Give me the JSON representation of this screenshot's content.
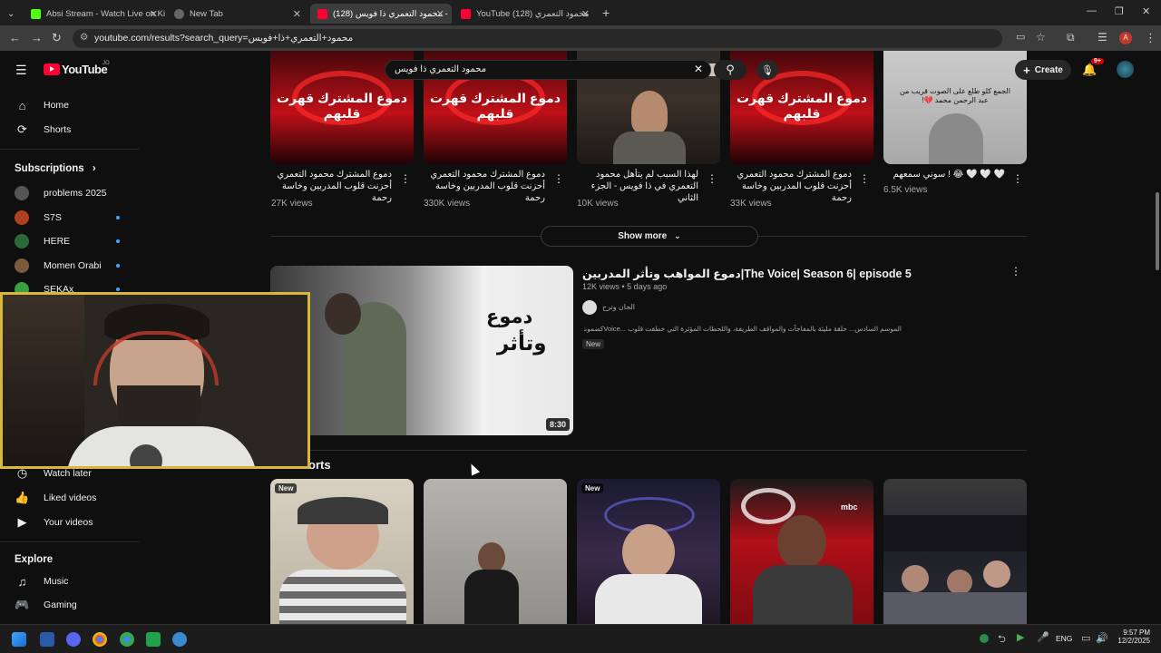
{
  "browser": {
    "tabs": [
      {
        "title": "Absi Stream - Watch Live on Ki",
        "favicon": "kick-icon",
        "color": "#53fc18"
      },
      {
        "title": "New Tab",
        "favicon": "globe-icon",
        "color": "#888888"
      },
      {
        "title": "محمود التعمري ذا فويس (128) -",
        "favicon": "youtube-icon",
        "color": "#ff0033"
      },
      {
        "title": "YouTube محمود التعمري (128)",
        "favicon": "youtube-icon",
        "color": "#ff0033"
      }
    ],
    "url": "youtube.com/results?search_query=محمود+التعمري+ذا+فويس"
  },
  "youtube": {
    "logo": "YouTube",
    "country": "JO",
    "search_value": "محمود التعمري ذا فويس",
    "create_label": "Create",
    "notif_count": "9+",
    "avatar_letter": "A"
  },
  "sidebar": {
    "home": "Home",
    "shorts": "Shorts",
    "subscriptions": "Subscriptions",
    "subs": [
      {
        "name": "problems 2025",
        "color": "#555555",
        "live": false
      },
      {
        "name": "S7S",
        "color": "#b04020",
        "live": true
      },
      {
        "name": "HERE",
        "color": "#2a6a3a",
        "live": true
      },
      {
        "name": "Momen Orabi",
        "color": "#7a5a3a",
        "live": true
      },
      {
        "name": "SEKAx",
        "color": "#3aa040",
        "live": true
      }
    ],
    "watch_later": "Watch later",
    "liked": "Liked videos",
    "your_videos": "Your videos",
    "explore": "Explore",
    "music": "Music",
    "gaming": "Gaming"
  },
  "top_row": [
    {
      "title": "دموع المشترك محمود التعمري أحزنت قلوب المدربين وخاسة رحمة",
      "views": "27K views",
      "thumb_text": "دموع المشترك قهرت قلبهم"
    },
    {
      "title": "دموع المشترك محمود التعمري أحزنت قلوب المدربين وخاسة رحمة",
      "views": "330K views",
      "thumb_text": "دموع المشترك قهرت قلبهم"
    },
    {
      "title": "لهذا السبب لم يتأهل محمود التعمري في ذا فويس - الجزء الثاني",
      "views": "10K views",
      "thumb_text": ""
    },
    {
      "title": "دموع المشترك محمود التعمري أحزنت قلوب المدربين وخاسة رحمة",
      "views": "33K views",
      "thumb_text": "دموع المشترك قهرت قلبهم"
    },
    {
      "title": "🤍 🤍 🤍 😂 ! سوني سمعهم",
      "views": "6.5K views",
      "thumb_text": "الجمع كلو طلع على الصوت قريب من عبد الرحمن محمد 💔!"
    }
  ],
  "show_more": "Show more",
  "featured": {
    "title": "دموع المواهب وتأثر المدربين|The Voice| Season 6| episode 5",
    "meta": "12K views • 5 days ago",
    "channel": "الحان وترح",
    "desc": "الموسم السادس... حلقة مليئة بالمفاجآت والمواقف الطريفة، واللحظات المؤثرة التي خطفت قلوب ...Voiceكضمونا الحلقة الخامسة من The",
    "badge": "New",
    "duration": "8:30",
    "thumb_text_1": "دموع",
    "thumb_text_2": "وتأثر"
  },
  "shorts_label": "orts",
  "shorts": [
    {
      "badge": "New"
    },
    {
      "badge": ""
    },
    {
      "badge": "New"
    },
    {
      "badge": ""
    },
    {
      "badge": ""
    }
  ],
  "taskbar": {
    "lang": "ENG",
    "time": "9:57 PM",
    "date": "12/2/2025"
  }
}
